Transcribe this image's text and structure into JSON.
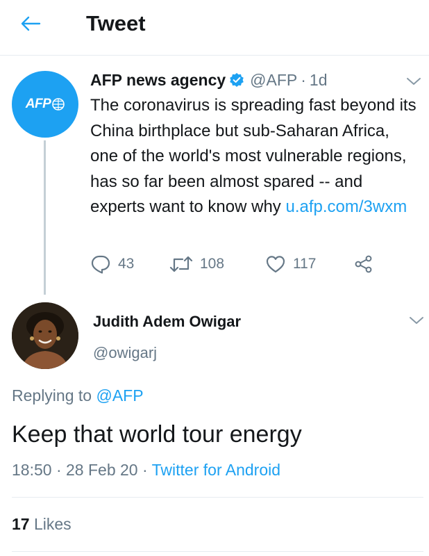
{
  "header": {
    "title": "Tweet",
    "back_icon": "arrow-left-icon",
    "accent_color": "#1da1f2"
  },
  "parent_tweet": {
    "author_name": "AFP news agency",
    "verified": true,
    "handle": "@AFP",
    "separator": "·",
    "time": "1d",
    "avatar_text": "AFP",
    "text": "The coronavirus is spreading fast beyond its China birthplace but sub-Saharan Africa, one of the world's most vulnerable regions, has so far been almost spared -- and experts want to know why",
    "link": "u.afp.com/3wxm",
    "replies": "43",
    "retweets": "108",
    "likes": "117"
  },
  "reply": {
    "author_name": "Judith Adem Owigar",
    "handle": "@owigarj",
    "replying_prefix": "Replying to",
    "replying_to": "@AFP",
    "text": "Keep that world tour energy",
    "time": "18:50",
    "date": "28 Feb 20",
    "separator": "·",
    "source": "Twitter for Android",
    "likes_count": "17",
    "likes_label": "Likes"
  },
  "colors": {
    "primary_text": "#14171a",
    "secondary_text": "#657786",
    "link": "#1da1f2",
    "divider": "#e6ecf0",
    "thread_line": "#c4cfd6"
  }
}
